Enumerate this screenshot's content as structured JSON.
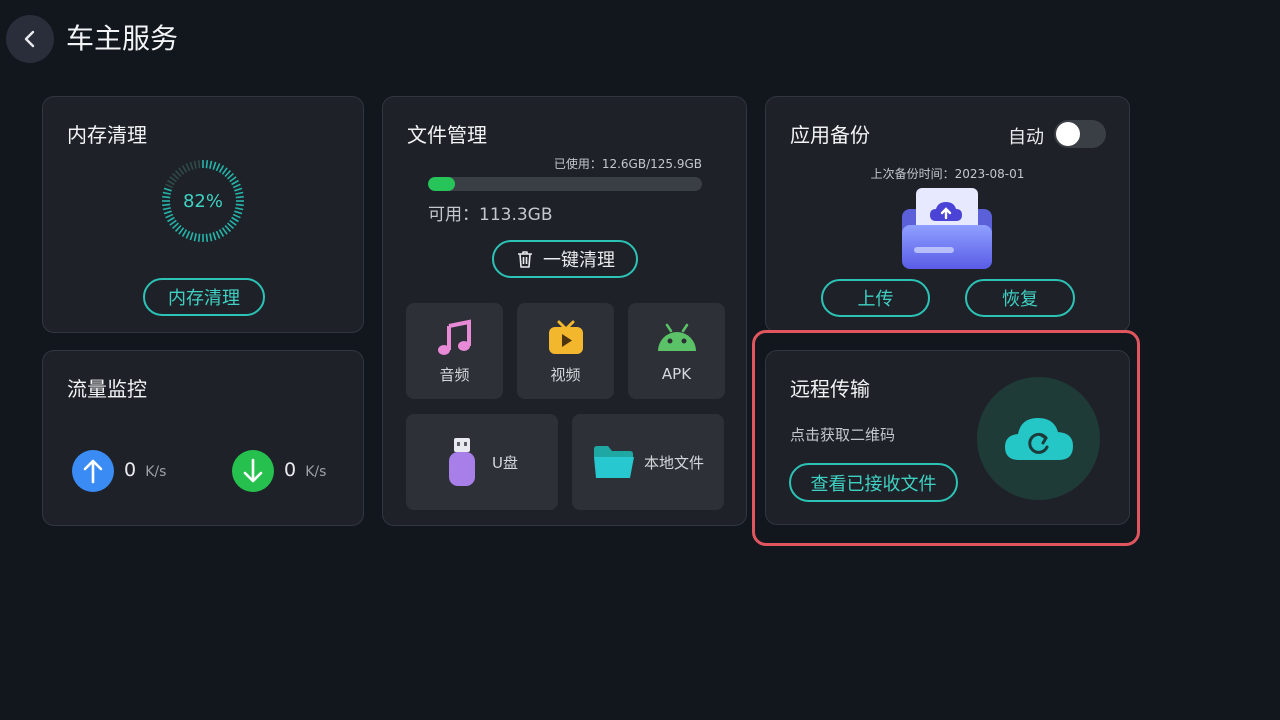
{
  "header": {
    "title": "车主服务"
  },
  "memory": {
    "title": "内存清理",
    "percent": 82,
    "percent_label": "82%",
    "button": "内存清理"
  },
  "traffic": {
    "title": "流量监控",
    "upload_value": "0",
    "upload_unit": "K/s",
    "download_value": "0",
    "download_unit": "K/s"
  },
  "files": {
    "title": "文件管理",
    "used_label": "已使用：12.6GB/125.9GB",
    "used_fraction": 0.1,
    "available_label": "可用：113.3GB",
    "clean_button": "一键清理",
    "tiles": [
      {
        "label": "音频",
        "icon": "music-icon"
      },
      {
        "label": "视频",
        "icon": "video-icon"
      },
      {
        "label": "APK",
        "icon": "android-icon"
      },
      {
        "label": "U盘",
        "icon": "usb-drive-icon"
      },
      {
        "label": "本地文件",
        "icon": "folder-icon"
      }
    ]
  },
  "backup": {
    "title": "应用备份",
    "auto_label": "自动",
    "auto_on": false,
    "last_time": "上次备份时间：2023-08-01",
    "upload_button": "上传",
    "restore_button": "恢复"
  },
  "remote": {
    "title": "远程传输",
    "hint": "点击获取二维码",
    "view_button": "查看已接收文件"
  },
  "colors": {
    "accent": "#2cc3b6",
    "progress_fill": "#27c45a",
    "upload_blue": "#3b8bf5",
    "download_green": "#26c04f",
    "highlight": "#e0565e"
  }
}
